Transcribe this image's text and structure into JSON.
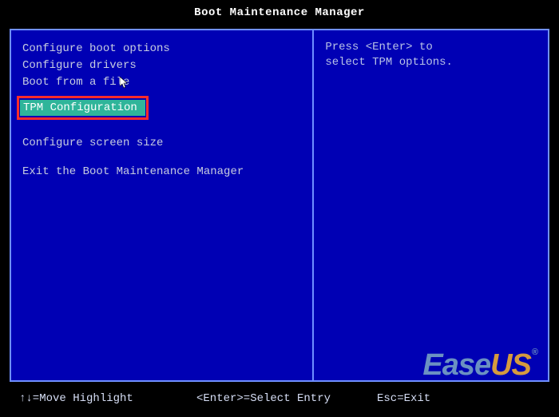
{
  "title": "Boot Maintenance Manager",
  "menu": {
    "items": [
      "Configure boot options",
      "Configure drivers",
      "Boot from a file"
    ],
    "selected": "TPM Configuration",
    "after1": "Configure screen size",
    "after2": "Exit the Boot Maintenance Manager"
  },
  "help": {
    "line1": "Press <Enter> to",
    "line2": "select TPM options."
  },
  "footer": {
    "left": "↑↓=Move Highlight",
    "center": "<Enter>=Select Entry",
    "right": "Esc=Exit"
  },
  "watermark": {
    "part1": "Ease",
    "part2": "US",
    "reg": "®"
  }
}
